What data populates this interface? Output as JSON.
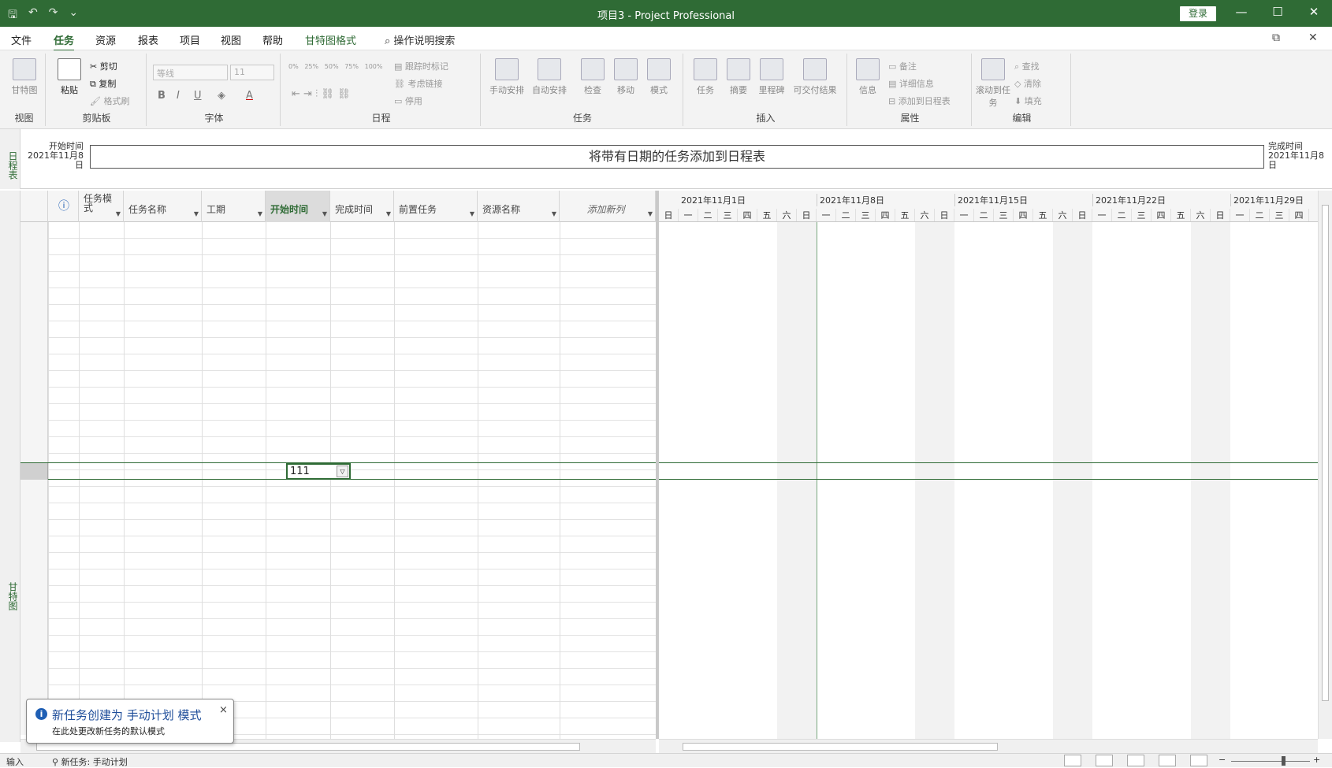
{
  "titlebar": {
    "title": "项目3  -  Project Professional",
    "login": "登录",
    "qat_save": "🖫",
    "qat_undo": "↶",
    "qat_redo": "↷",
    "qat_more": "⌄",
    "minimize": "—",
    "maximize": "☐",
    "close": "✕"
  },
  "menubar": {
    "tabs": [
      "文件",
      "任务",
      "资源",
      "报表",
      "项目",
      "视图",
      "帮助",
      "甘特图格式"
    ],
    "active_tab": "任务",
    "search_label": "操作说明搜索",
    "restore": "⧉",
    "close_doc": "✕"
  },
  "ribbon": {
    "groups": {
      "view": "视图",
      "clipboard": "剪贴板",
      "font": "字体",
      "schedule": "日程",
      "tasks": "任务",
      "insert": "插入",
      "properties": "属性",
      "editing": "编辑"
    },
    "view_gantt": "甘特图",
    "paste": "粘贴",
    "cut": "剪切",
    "copy": "复制",
    "format_painter": "格式刷",
    "font_name": "等线",
    "font_size": "11",
    "bold": "B",
    "italic": "I",
    "underline": "U",
    "pct": [
      "0%",
      "25%",
      "50%",
      "75%",
      "100%"
    ],
    "track_mark": "跟踪时标记",
    "respect_links": "考虑链接",
    "inactivate": "停用",
    "manual_schedule": "手动安排",
    "auto_schedule": "自动安排",
    "inspect": "检查",
    "move": "移动",
    "mode": "模式",
    "task": "任务",
    "summary": "摘要",
    "milestone": "里程碑",
    "deliverable": "可交付结果",
    "information": "信息",
    "notes": "备注",
    "details": "详细信息",
    "add_to_timeline": "添加到日程表",
    "scroll_to_task": "滚动到任务",
    "find": "查找",
    "clear": "清除",
    "fill": "填充"
  },
  "timeline": {
    "side_label": "日程表",
    "start_label": "开始时间",
    "start_date": "2021年11月8日",
    "end_label": "完成时间",
    "end_date": "2021年11月8日",
    "placeholder": "将带有日期的任务添加到日程表"
  },
  "gantt_side_label": "甘特图",
  "table": {
    "columns": [
      "任务模式",
      "任务名称",
      "工期",
      "开始时间",
      "完成时间",
      "前置任务",
      "资源名称",
      "添加新列"
    ],
    "selected_column": "开始时间",
    "info_icon": "ⓘ",
    "edit_value": "111"
  },
  "chart": {
    "weeks": [
      "2021年11月1日",
      "2021年11月8日",
      "2021年11月15日",
      "2021年11月22日",
      "2021年11月29日"
    ],
    "days": [
      "日",
      "一",
      "二",
      "三",
      "四",
      "五",
      "六"
    ]
  },
  "statusbar": {
    "mode": "输入",
    "new_task": "新任务: 手动计划",
    "zoom_minus": "−",
    "zoom_plus": "+"
  },
  "toast": {
    "title": "新任务创建为 手动计划 模式",
    "subtitle": "在此处更改新任务的默认模式",
    "close": "×"
  },
  "colors": {
    "accent": "#2f6b35",
    "info_blue": "#1f5fb4"
  }
}
